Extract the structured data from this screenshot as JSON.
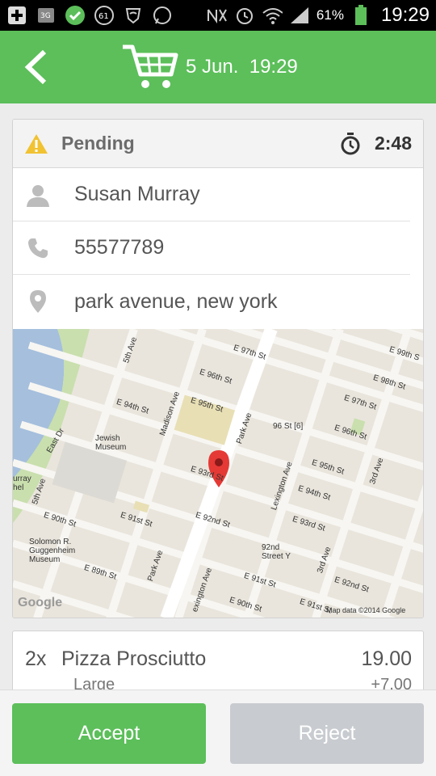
{
  "status_bar": {
    "battery_percent": "61%",
    "time": "19:29",
    "badge_count": "61",
    "network_label": "3G"
  },
  "header": {
    "title": "5 Jun.  19:29"
  },
  "order": {
    "status": "Pending",
    "timer": "2:48",
    "customer_name": "Susan  Murray",
    "phone": "55577789",
    "address": "park avenue, new york"
  },
  "map": {
    "attribution": "Map data ©2014 Google",
    "logo_text": "Google",
    "labels": {
      "e97": "E 97th St",
      "e99": "E 99th S",
      "e96a": "E 96th St",
      "e98": "E 98th St",
      "e95a": "E 95th St",
      "e97b": "E 97th St",
      "e94a": "E 94th St",
      "st96": "96 St [6]",
      "e96b": "E 96th St",
      "fifth_top": "5th Ave",
      "madison": "Madison Ave",
      "park_top": "Park Ave",
      "jewish": "Jewish\nMuseum",
      "east_dr": "East Dr",
      "e93a": "E 93rd St",
      "lex": "Lexington Ave",
      "e95b": "E 95th St",
      "third_top": "3rd Ave",
      "e94b": "E 94th St",
      "fifth_left": "5th Ave",
      "e90a": "E 90th St",
      "e91a": "E 91st St",
      "e92a": "E 92nd St",
      "e93b": "E 93rd St",
      "murray": "urray\nhel",
      "guggenheim": "Solomon R.\nGuggenheim\nMuseum",
      "e89": "E 89th St",
      "park_bot": "Park Ave",
      "st92": "92nd\nStreet Y",
      "e91b": "E 91st St",
      "third_bot": "3rd Ave",
      "e92b": "E 92nd St",
      "lex_bot": "exington Ave",
      "e90b": "E 90th St",
      "e91c": "E 91st St"
    }
  },
  "item": {
    "qty": "2x",
    "name": "Pizza Prosciutto",
    "price": "19.00",
    "option": "Large",
    "option_price": "+7.00"
  },
  "actions": {
    "accept": "Accept",
    "reject": "Reject"
  },
  "colors": {
    "brand_green": "#5cbf5a",
    "warning_yellow": "#f1c232",
    "reject_gray": "#c8cbcf"
  }
}
